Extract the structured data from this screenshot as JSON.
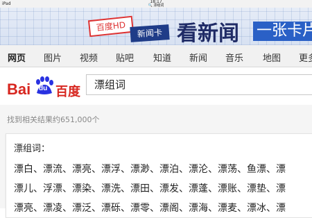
{
  "status": {
    "device": "iPad",
    "time": "18:17",
    "url": "漂组词"
  },
  "banner": {
    "hd_badge": "百度HD",
    "card_badge": "新闻卡",
    "headline": "看新闻",
    "slogan": "一张卡片"
  },
  "nav": {
    "tabs": [
      "网页",
      "图片",
      "视频",
      "贴吧",
      "知道",
      "新闻",
      "音乐",
      "地图",
      "更多"
    ],
    "active": "网页"
  },
  "search": {
    "logo_latin": "Bai",
    "logo_paw": "du",
    "logo_cn": "百度",
    "query": "漂组词"
  },
  "results": {
    "count_text": "找到相关结果约651,000个",
    "card_title": "漂组词：",
    "rows": [
      "漂白、漂流、漂亮、漂浮、漂渺、漂泊、漂沦、漂荡、鱼漂、漂",
      "漂儿、浮漂、漂染、漂洗、漂田、漂发、漂蓬、漂账、漂垫、漂",
      "漂亮、漂凌、漂泛、漂砾、漂零、漂阁、漂海、漂麦、漂冰、漂"
    ]
  },
  "colors": {
    "accent_red": "#d7261f",
    "accent_blue": "#2a60c6"
  }
}
